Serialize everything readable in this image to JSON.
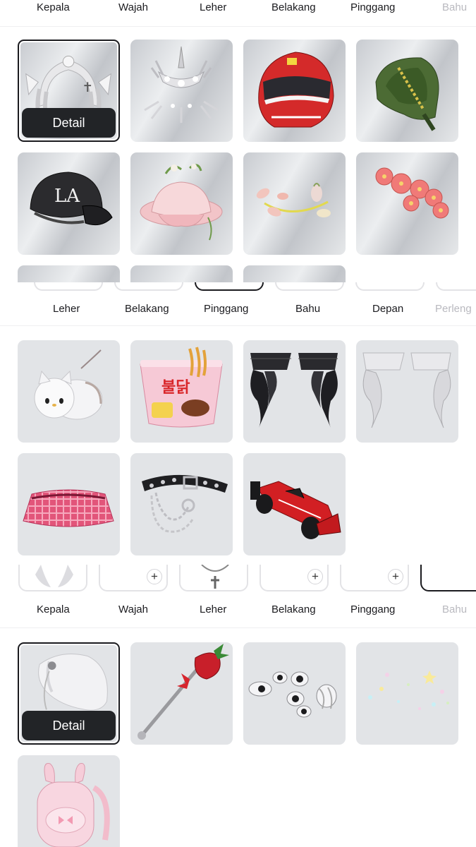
{
  "panels": [
    {
      "tabs": [
        "Kepala",
        "Wajah",
        "Leher",
        "Belakang",
        "Pinggang",
        "Bahu"
      ],
      "selected_item_action": "Detail",
      "items": [
        {
          "icon": "white-bow-headpiece-icon",
          "selected": true
        },
        {
          "icon": "silver-crown-icon"
        },
        {
          "icon": "racing-helmet-icon"
        },
        {
          "icon": "green-hood-icon"
        },
        {
          "icon": "black-baseball-cap-icon"
        },
        {
          "icon": "pink-flower-hat-icon"
        },
        {
          "icon": "flower-vine-crown-icon"
        },
        {
          "icon": "pink-flower-headband-icon"
        }
      ]
    },
    {
      "tabs": [
        "Leher",
        "Belakang",
        "Pinggang",
        "Bahu",
        "Depan",
        "Perleng"
      ],
      "items": [
        {
          "icon": "white-cat-plush-icon"
        },
        {
          "icon": "instant-noodle-cup-icon"
        },
        {
          "icon": "black-skirt-ruffles-icon"
        },
        {
          "icon": "white-skirt-ruffles-icon"
        },
        {
          "icon": "pink-plaid-skirt-icon"
        },
        {
          "icon": "chain-belt-icon"
        },
        {
          "icon": "red-race-car-icon"
        }
      ]
    },
    {
      "tabs": [
        "Kepala",
        "Wajah",
        "Leher",
        "Belakang",
        "Pinggang",
        "Bahu"
      ],
      "slot_add_symbol": "+",
      "selected_item_action": "Detail",
      "items": [
        {
          "icon": "white-veil-shoulder-icon",
          "selected": true
        },
        {
          "icon": "strawberry-wand-icon"
        },
        {
          "icon": "floating-eyes-icon"
        },
        {
          "icon": "sparkle-stars-icon"
        },
        {
          "icon": "pink-bunny-backpack-icon"
        }
      ]
    }
  ],
  "colors": {
    "selected_border": "#1b1b1f",
    "detail_button": "#222427",
    "faded_tab": "#b9b9bf"
  }
}
